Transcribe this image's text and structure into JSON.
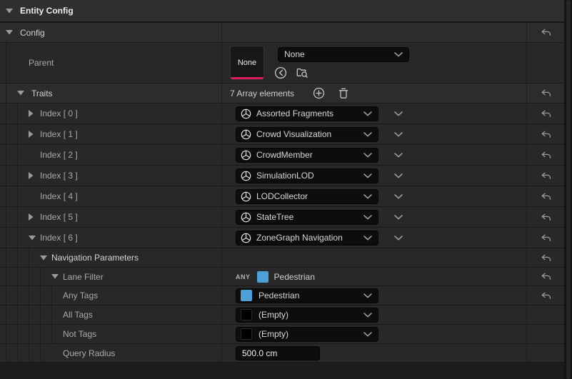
{
  "panel": {
    "title": "Entity Config"
  },
  "config": {
    "label": "Config"
  },
  "parent": {
    "label": "Parent",
    "thumbnail_text": "None",
    "selected_value": "None"
  },
  "traits": {
    "label": "Traits",
    "count_text": "7 Array elements",
    "items": [
      {
        "label": "Index [ 0 ]",
        "value": "Assorted Fragments"
      },
      {
        "label": "Index [ 1 ]",
        "value": "Crowd Visualization"
      },
      {
        "label": "Index [ 2 ]",
        "value": "CrowdMember"
      },
      {
        "label": "Index [ 3 ]",
        "value": "SimulationLOD"
      },
      {
        "label": "Index [ 4 ]",
        "value": "LODCollector"
      },
      {
        "label": "Index [ 5 ]",
        "value": "StateTree"
      },
      {
        "label": "Index [ 6 ]",
        "value": "ZoneGraph Navigation"
      }
    ]
  },
  "navigation_parameters": {
    "label": "Navigation Parameters"
  },
  "lane_filter": {
    "label": "Lane Filter",
    "match_mode": "ANY",
    "summary_tag": "Pedestrian"
  },
  "tags": {
    "any": {
      "label": "Any Tags",
      "value": "Pedestrian"
    },
    "all": {
      "label": "All Tags",
      "value": "(Empty)"
    },
    "not": {
      "label": "Not Tags",
      "value": "(Empty)"
    }
  },
  "query_radius": {
    "label": "Query Radius",
    "value": "500.0 cm"
  },
  "colors": {
    "asset_accent_pink": "#d81b5e",
    "tag_blue": "#4fa0d8",
    "tag_empty": "#000000"
  },
  "icons": {
    "expander_open": "triangle-down",
    "expander_closed": "triangle-right",
    "trait": "mass-trait-sphere",
    "combo": "chevron-down",
    "add": "plus-circle",
    "delete": "trash",
    "use_selected": "circle-left-arrow",
    "browse": "folder-search",
    "reset": "undo-arrow"
  }
}
